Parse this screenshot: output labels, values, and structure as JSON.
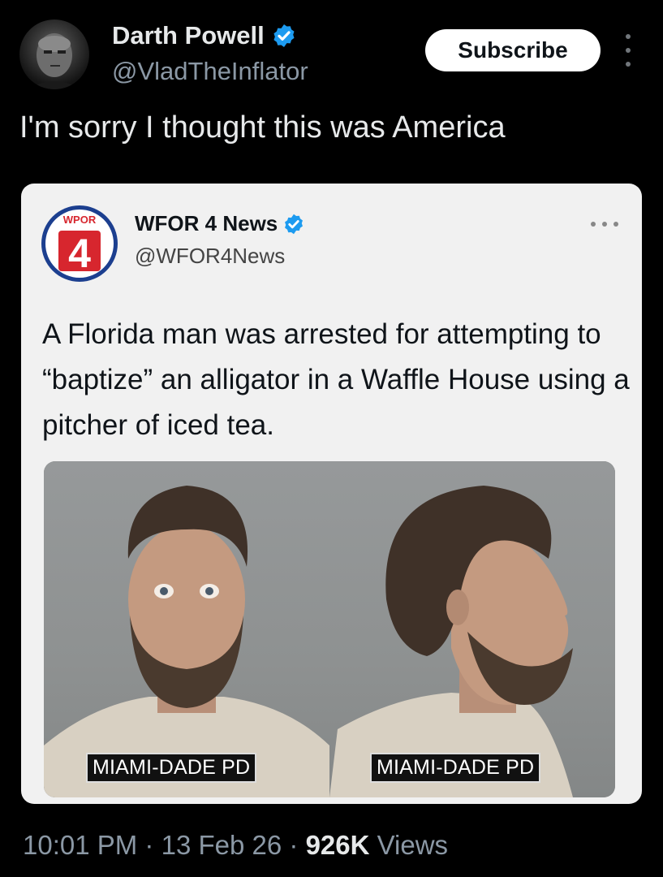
{
  "author": {
    "name": "Darth Powell",
    "handle": "@VladTheInflator",
    "verified": true
  },
  "header": {
    "subscribe_label": "Subscribe",
    "more_icon": "more-vertical-icon"
  },
  "tweet": {
    "text": "I'm sorry I thought this was America"
  },
  "quoted_card": {
    "logo_text": "WPOR",
    "logo_number": "4",
    "name": "WFOR 4 News",
    "handle": "@WFOR4News",
    "verified": true,
    "text": "A Florida man was arrested for attempting to “baptize” an alligator in a Waffle House using a pitcher of iced tea.",
    "photos": [
      {
        "caption": "MIAMI-DADE PD",
        "view": "front"
      },
      {
        "caption": "MIAMI-DADE PD",
        "view": "profile"
      }
    ]
  },
  "meta": {
    "time": "10:01 PM",
    "separator": "·",
    "date": "13 Feb 26",
    "views_count": "926K",
    "views_label": "Views"
  },
  "colors": {
    "background": "#000000",
    "verified_badge": "#1d9bf0",
    "secondary_text": "#8b98a5",
    "logo_red": "#d7262e",
    "logo_blue": "#1c3f8f"
  }
}
